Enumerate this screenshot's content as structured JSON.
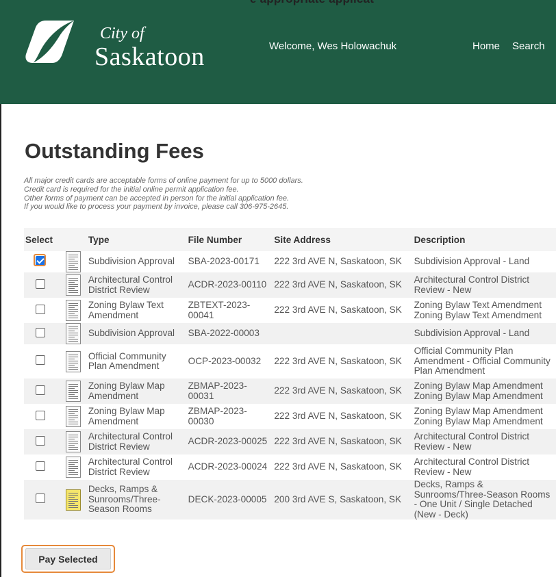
{
  "top_clip_text": "e appropriate applicat",
  "header": {
    "logo_line1": "City of",
    "logo_line2": "Saskatoon",
    "welcome": "Welcome, Wes Holowachuk",
    "nav": [
      "Home",
      "Search"
    ]
  },
  "page_title": "Outstanding Fees",
  "notes": [
    "All major credit cards are acceptable forms of online payment for up to 5000 dollars.",
    "Credit card is required for the initial online permit application fee.",
    "Other forms of payment can be accepted in person for the initial application fee.",
    "If you would like to process your payment by invoice, please call 306-975-2645."
  ],
  "table": {
    "headers": [
      "Select",
      "",
      "Type",
      "File Number",
      "Site Address",
      "Description"
    ],
    "rows": [
      {
        "checked": true,
        "icon": "document-icon",
        "type": "Subdivision Approval",
        "file": "SBA-2023-00171",
        "address": "222 3rd AVE N, Saskatoon, SK",
        "description": "Subdivision Approval - Land"
      },
      {
        "checked": false,
        "icon": "document-icon",
        "type": "Architectural Control District Review",
        "file": "ACDR-2023-00110",
        "address": "222 3rd AVE N, Saskatoon, SK",
        "description": "Architectural Control District Review - New"
      },
      {
        "checked": false,
        "icon": "document-icon",
        "type": "Zoning Bylaw Text Amendment",
        "file": "ZBTEXT-2023-00041",
        "address": "222 3rd AVE N, Saskatoon, SK",
        "description": "Zoning Bylaw Text Amendment Zoning Bylaw Text Amendment"
      },
      {
        "checked": false,
        "icon": "document-icon",
        "type": "Subdivision Approval",
        "file": "SBA-2022-00003",
        "address": "",
        "description": "Subdivision Approval - Land"
      },
      {
        "checked": false,
        "icon": "document-icon",
        "type": "Official Community Plan Amendment",
        "file": "OCP-2023-00032",
        "address": "222 3rd AVE N, Saskatoon, SK",
        "description": "Official Community Plan Amendment - Official Community Plan Amendment"
      },
      {
        "checked": false,
        "icon": "document-icon",
        "type": "Zoning Bylaw Map Amendment",
        "file": "ZBMAP-2023-00031",
        "address": "222 3rd AVE N, Saskatoon, SK",
        "description": "Zoning Bylaw Map Amendment Zoning Bylaw Map Amendment"
      },
      {
        "checked": false,
        "icon": "document-icon",
        "type": "Zoning Bylaw Map Amendment",
        "file": "ZBMAP-2023-00030",
        "address": "222 3rd AVE N, Saskatoon, SK",
        "description": "Zoning Bylaw Map Amendment Zoning Bylaw Map Amendment"
      },
      {
        "checked": false,
        "icon": "document-icon",
        "type": "Architectural Control District Review",
        "file": "ACDR-2023-00025",
        "address": "222 3rd AVE N, Saskatoon, SK",
        "description": "Architectural Control District Review - New"
      },
      {
        "checked": false,
        "icon": "document-icon",
        "type": "Architectural Control District Review",
        "file": "ACDR-2023-00024",
        "address": "222 3rd AVE N, Saskatoon, SK",
        "description": "Architectural Control District Review - New"
      },
      {
        "checked": false,
        "icon": "yellow-document-icon",
        "type": "Decks, Ramps & Sunrooms/Three-Season Rooms",
        "file": "DECK-2023-00005",
        "address": "200 3rd AVE S, Saskatoon, SK",
        "description": "Decks, Ramps & Sunrooms/Three-Season Rooms - One Unit / Single Detached (New - Deck)"
      }
    ]
  },
  "pay_button_label": "Pay Selected",
  "colors": {
    "header_bg": "#1f5c44",
    "highlight": "#e6893a",
    "checkbox_checked": "#1a73e8"
  }
}
